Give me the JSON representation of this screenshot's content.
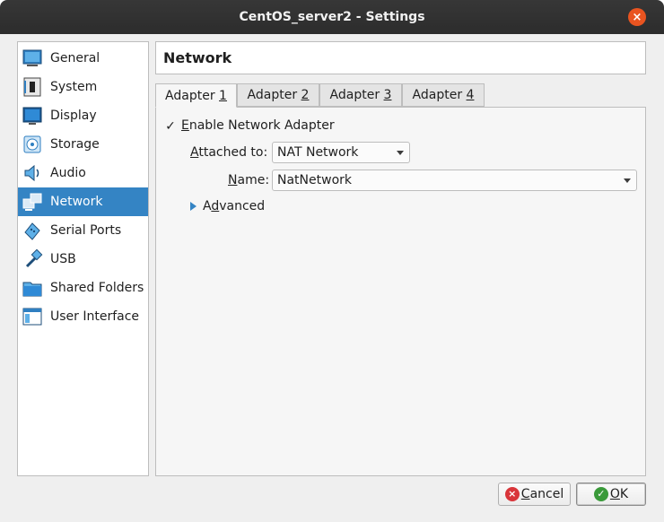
{
  "window": {
    "title": "CentOS_server2 - Settings",
    "close_glyph": "×"
  },
  "sidebar": {
    "items": [
      {
        "label": "General",
        "icon": "general-icon"
      },
      {
        "label": "System",
        "icon": "system-icon"
      },
      {
        "label": "Display",
        "icon": "display-icon"
      },
      {
        "label": "Storage",
        "icon": "storage-icon"
      },
      {
        "label": "Audio",
        "icon": "audio-icon"
      },
      {
        "label": "Network",
        "icon": "network-icon",
        "selected": true
      },
      {
        "label": "Serial Ports",
        "icon": "serial-ports-icon"
      },
      {
        "label": "USB",
        "icon": "usb-icon"
      },
      {
        "label": "Shared Folders",
        "icon": "shared-folders-icon"
      },
      {
        "label": "User Interface",
        "icon": "user-interface-icon"
      }
    ]
  },
  "section": {
    "title": "Network"
  },
  "tabs": [
    {
      "prefix": "Adapter ",
      "mnemonic": "1",
      "active": true
    },
    {
      "prefix": "Adapter ",
      "mnemonic": "2"
    },
    {
      "prefix": "Adapter ",
      "mnemonic": "3"
    },
    {
      "prefix": "Adapter ",
      "mnemonic": "4"
    }
  ],
  "adapter": {
    "enable_check": "✓",
    "enable_mnemonic": "E",
    "enable_rest": "nable Network Adapter",
    "enabled": true,
    "attached_mnemonic": "A",
    "attached_rest": "ttached to:",
    "attached_value": "NAT Network",
    "name_mnemonic": "N",
    "name_rest": "ame:",
    "name_value": "NatNetwork",
    "advanced_prefix": "A",
    "advanced_mnemonic": "d",
    "advanced_rest": "vanced"
  },
  "buttons": {
    "cancel_mnemonic": "C",
    "cancel_rest": "ancel",
    "cancel_glyph": "×",
    "ok_mnemonic": "O",
    "ok_rest": "K",
    "ok_glyph": "✓"
  },
  "colors": {
    "accent": "#3484c4",
    "close": "#e95420",
    "cancel_icon": "#d9353a",
    "ok_icon": "#3a9a3a"
  }
}
